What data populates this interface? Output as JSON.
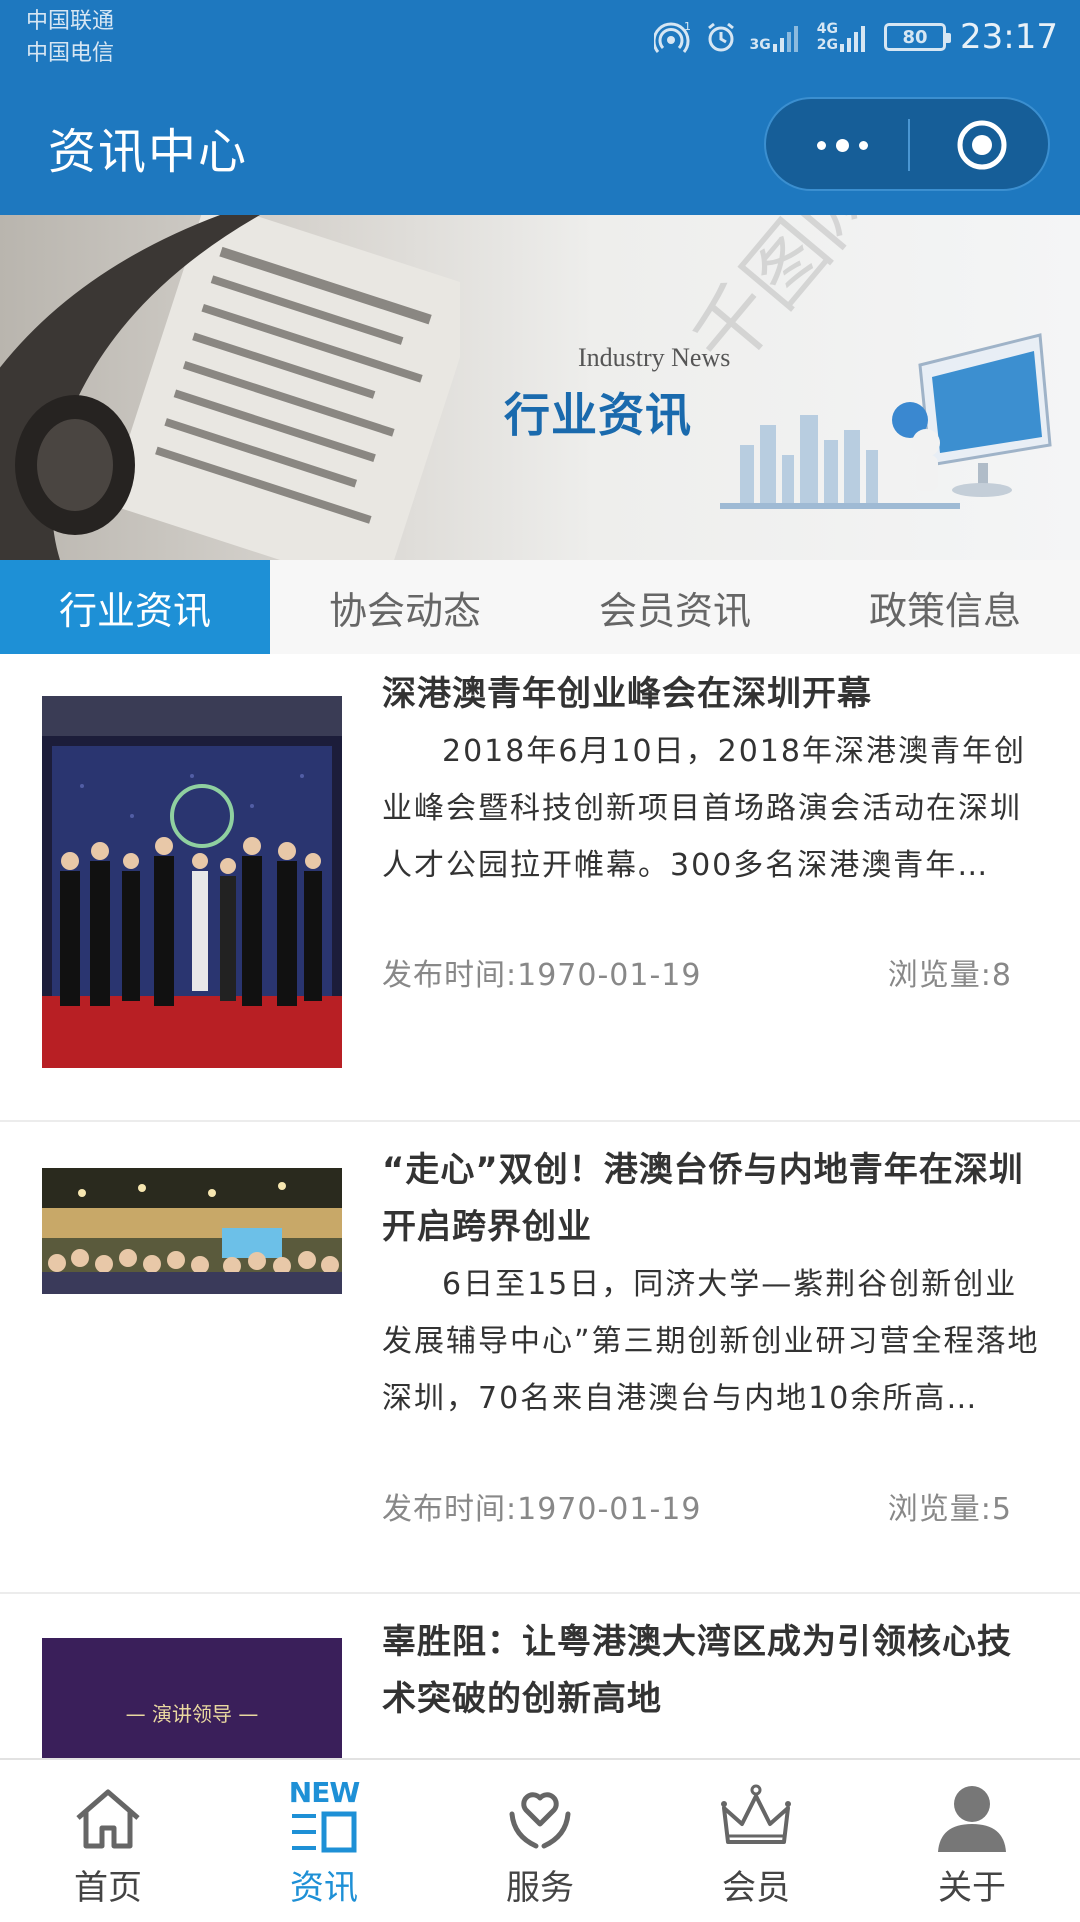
{
  "status_bar": {
    "carrier_1": "中国联通",
    "carrier_2": "中国电信",
    "net_1": "3G",
    "net_2": "4G",
    "net_3": "2G",
    "battery": "80",
    "time": "23:17"
  },
  "header": {
    "title": "资讯中心",
    "more_icon": "more-dots-icon",
    "close_icon": "target-circle-icon"
  },
  "banner": {
    "subtitle_en": "Industry News",
    "title_cn": "行业资讯",
    "watermark": "千图网"
  },
  "tabs": [
    {
      "label": "行业资讯",
      "active": true
    },
    {
      "label": "协会动态",
      "active": false
    },
    {
      "label": "会员资讯",
      "active": false
    },
    {
      "label": "政策信息",
      "active": false
    }
  ],
  "articles": [
    {
      "title": "深港澳青年创业峰会在深圳开幕",
      "summary": "2018年6月10日，2018年深港澳青年创业峰会暨科技创新项目首场路演会活动在深圳人才公园拉开帷幕。300多名深港澳青年…",
      "date": "发布时间:1970-01-19",
      "views": "浏览量:8"
    },
    {
      "title": "“走心”双创！港澳台侨与内地青年在深圳开启跨界创业",
      "summary": "6日至15日，同济大学—紫荆谷创新创业发展辅导中心”第三期创新创业研习营全程落地深圳，70名来自港澳台与内地10余所高…",
      "date": "发布时间:1970-01-19",
      "views": "浏览量:5"
    },
    {
      "title": "辜胜阻：让粤港澳大湾区成为引领核心技术突破的创新高地",
      "thumb_caption": "— 演讲领导 —"
    }
  ],
  "tabbar": [
    {
      "label": "首页",
      "icon": "home-icon",
      "active": false
    },
    {
      "label": "资讯",
      "icon": "news-icon",
      "badge": "NEW",
      "active": true
    },
    {
      "label": "服务",
      "icon": "heart-hands-icon",
      "active": false
    },
    {
      "label": "会员",
      "icon": "crown-icon",
      "active": false
    },
    {
      "label": "关于",
      "icon": "person-icon",
      "active": false
    }
  ],
  "colors": {
    "header_bg": "#1e78bf",
    "tab_active_bg": "#1e90d6",
    "tab_active_text": "#1e90d6"
  }
}
